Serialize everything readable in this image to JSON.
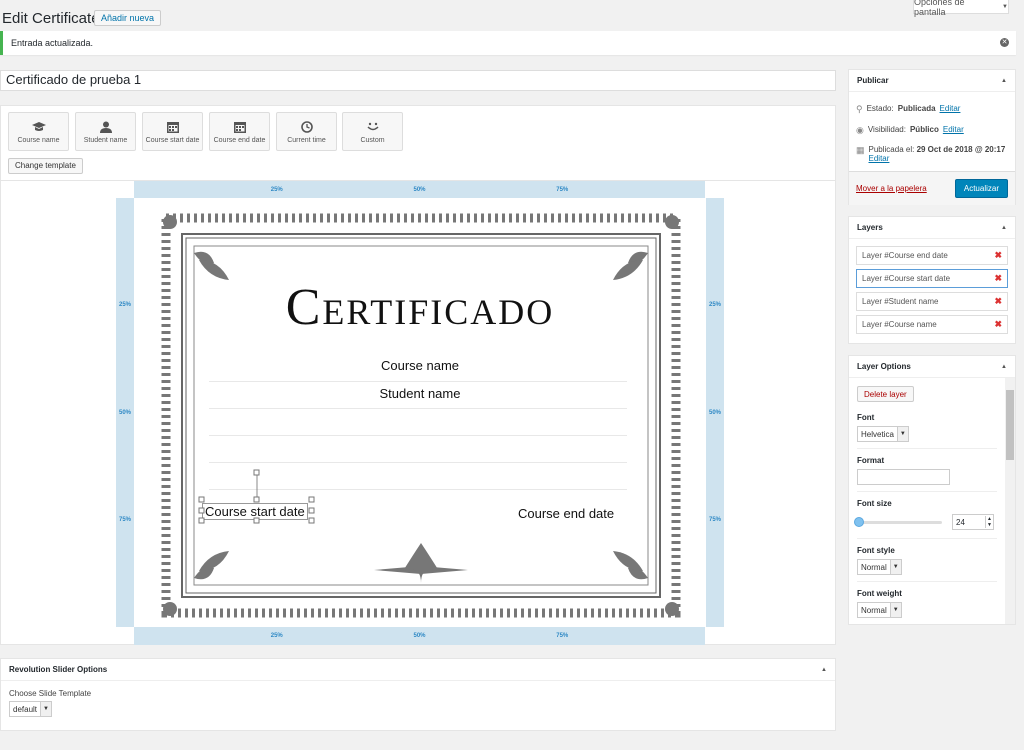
{
  "header": {
    "title": "Edit Certificate",
    "add_new": "Añadir nueva",
    "screen_options": "Opciones de pantalla"
  },
  "notice": {
    "text": "Entrada actualizada."
  },
  "post_title": "Certificado de prueba 1",
  "toolbar": {
    "items": [
      {
        "label": "Course name",
        "icon": "graduation-cap-icon"
      },
      {
        "label": "Student name",
        "icon": "user-icon"
      },
      {
        "label": "Course start date",
        "icon": "calendar-icon"
      },
      {
        "label": "Course end date",
        "icon": "calendar-icon"
      },
      {
        "label": "Current time",
        "icon": "clock-icon"
      },
      {
        "label": "Custom",
        "icon": "smiley-icon"
      }
    ],
    "change_template": "Change template"
  },
  "rulers": {
    "ticks": [
      "25%",
      "50%",
      "75%"
    ]
  },
  "certificate": {
    "title": "Certificado",
    "course_name": "Course name",
    "student_name": "Student name",
    "course_start_date": "Course start date",
    "course_end_date": "Course end date"
  },
  "publish": {
    "title": "Publicar",
    "status_label": "Estado:",
    "status_value": "Publicada",
    "visibility_label": "Visibilidad:",
    "visibility_value": "Público",
    "published_label": "Publicada el:",
    "published_value": "29 Oct de 2018 @ 20:17",
    "edit": "Editar",
    "trash": "Mover a la papelera",
    "update": "Actualizar"
  },
  "layers": {
    "title": "Layers",
    "items": [
      {
        "label": "Layer #Course end date"
      },
      {
        "label": "Layer #Course start date"
      },
      {
        "label": "Layer #Student name"
      },
      {
        "label": "Layer #Course name"
      }
    ]
  },
  "layer_options": {
    "title": "Layer Options",
    "delete": "Delete layer",
    "font_label": "Font",
    "font_value": "Helvetica",
    "format_label": "Format",
    "format_value": "",
    "font_size_label": "Font size",
    "font_size_value": "24",
    "font_style_label": "Font style",
    "font_style_value": "Normal",
    "font_weight_label": "Font weight",
    "font_weight_value": "Normal"
  },
  "revslider": {
    "title": "Revolution Slider Options",
    "template_label": "Choose Slide Template",
    "template_value": "default"
  },
  "colors": {
    "accent": "#0073aa",
    "success": "#46b450",
    "danger": "#dc3232",
    "ruler": "#cfe3ef"
  }
}
